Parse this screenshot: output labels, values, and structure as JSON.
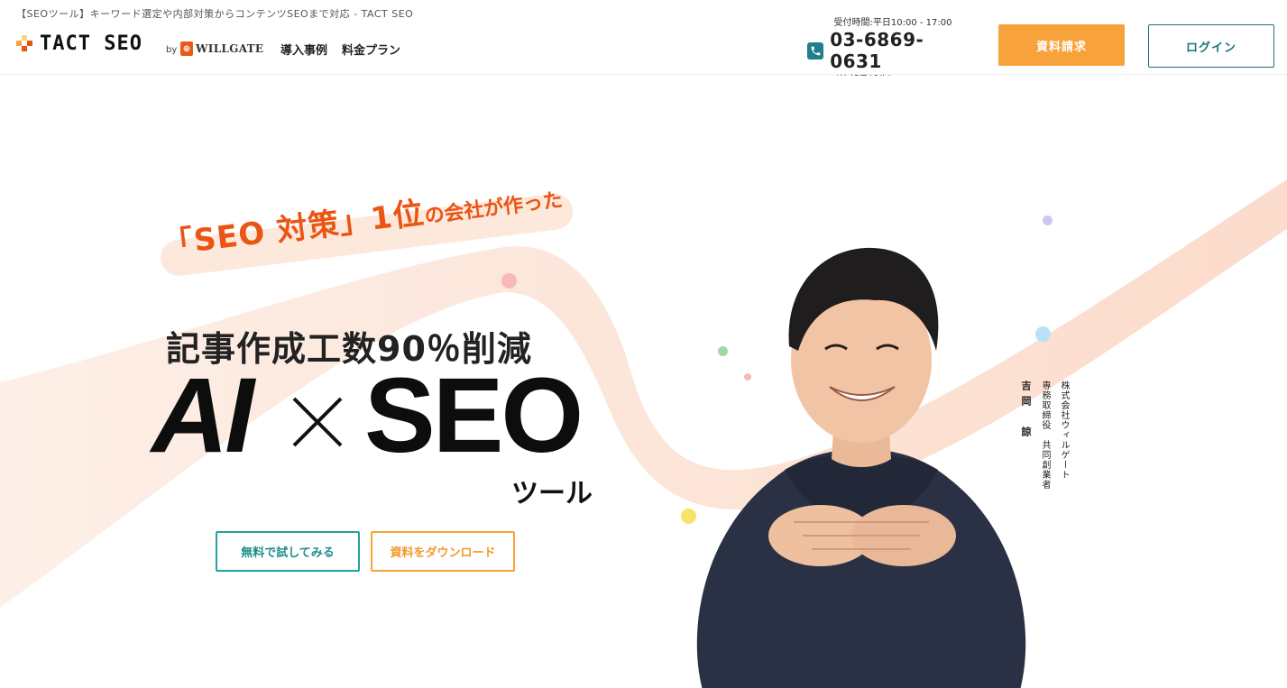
{
  "header": {
    "tagline": "【SEOツール】キーワード選定や内部対策からコンテンツSEOまで対応 - TACT SEO",
    "logo_text": "TACT SEO",
    "by_text": "by",
    "company_logo_text": "WILLGATE",
    "nav": [
      "導入事例",
      "料金プラン"
    ],
    "hours": "受付時間:平日10:00 - 17:00",
    "phone": "03-6869-0631",
    "phone_note": "（外部委託先）",
    "request_button": "資料請求",
    "login_button": "ログイン"
  },
  "hero": {
    "catch_big": "「SEO 対策」1位",
    "catch_small": "の会社が作った",
    "reduction": "記事作成工数90％削減",
    "ai": "AI",
    "seo": "SEO",
    "tool": "ツール",
    "trial_button": "無料で試してみる",
    "download_button": "資料をダウンロード",
    "caption_company": "株式会社ウィルゲート",
    "caption_title": "専務取締役　共同創業者",
    "caption_name": "吉岡　諒"
  },
  "colors": {
    "accent_orange": "#f7a23b",
    "catch_orange": "#ea5514",
    "teal": "#1f6f7a",
    "trial_teal": "#24a29c"
  }
}
